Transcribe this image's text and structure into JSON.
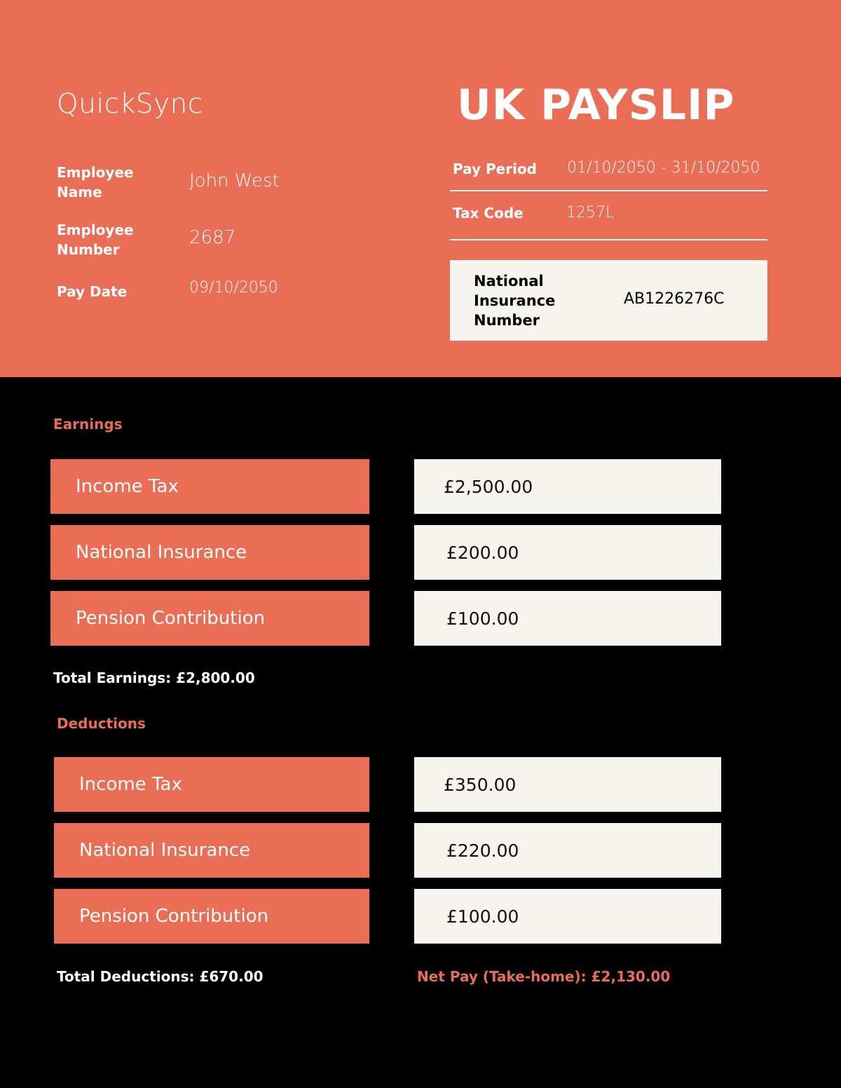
{
  "header": {
    "brand": "QuickSync",
    "title": "UK PAYSLIP",
    "employee_name_label": "Employee Name",
    "employee_name": "John West",
    "employee_number_label": "Employee Number",
    "employee_number": "2687",
    "pay_date_label": "Pay Date",
    "pay_date": "09/10/2050",
    "pay_period_label": "Pay Period",
    "pay_period": "01/10/2050 - 31/10/2050",
    "tax_code_label": "Tax Code",
    "tax_code": "1257L",
    "ni_label": "National Insurance Number",
    "ni_number": "AB1226276C"
  },
  "earnings": {
    "title": "Earnings",
    "rows": [
      {
        "label": "Income Tax",
        "value": "£2,500.00"
      },
      {
        "label": "National Insurance",
        "value": "£200.00"
      },
      {
        "label": "Pension Contribution",
        "value": "£100.00"
      }
    ],
    "total": "Total Earnings: £2,800.00"
  },
  "deductions": {
    "title": "Deductions",
    "rows": [
      {
        "label": "Income Tax",
        "value": "£350.00"
      },
      {
        "label": "National Insurance",
        "value": "£220.00"
      },
      {
        "label": "Pension Contribution",
        "value": "£100.00"
      }
    ],
    "total": "Total Deductions: £670.00",
    "net_pay": "Net Pay (Take-home): £2,130.00"
  },
  "colors": {
    "accent": "#EA6E55",
    "panel": "#F5F4EF",
    "background": "#000000"
  }
}
